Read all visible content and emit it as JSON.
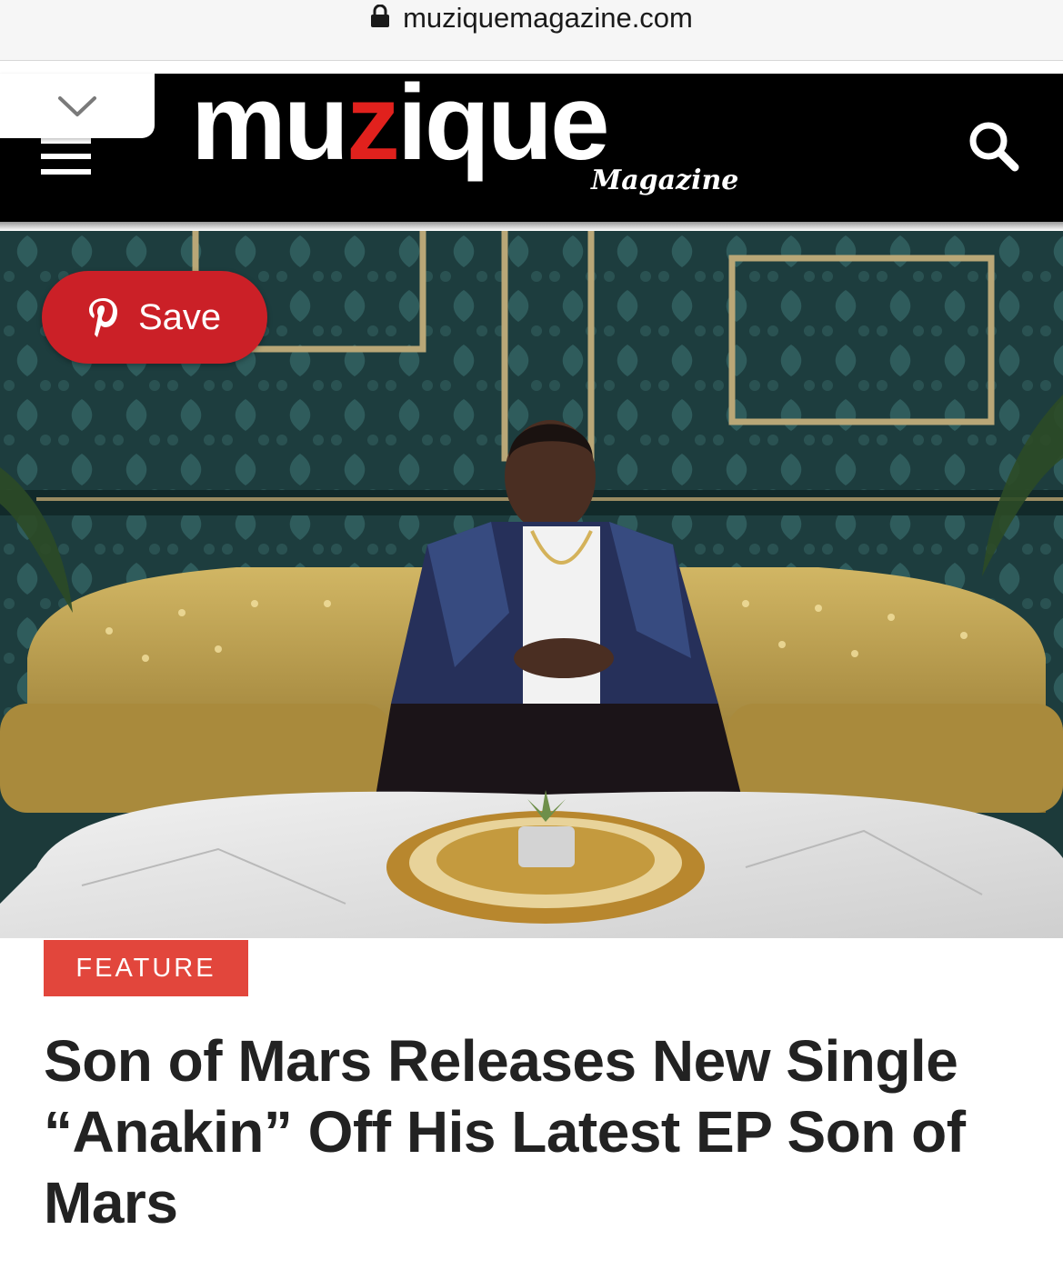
{
  "browser": {
    "url": "muziquemagazine.com"
  },
  "header": {
    "logo_main_pre": "mu",
    "logo_main_accent": "z",
    "logo_main_post": "ique",
    "logo_sub": "Magazine"
  },
  "hero": {
    "save_label": "Save"
  },
  "article": {
    "category": "FEATURE",
    "title": "Son of Mars Releases New Single “Anakin” Off His Latest EP Son of Mars"
  },
  "colors": {
    "header_bg": "#000000",
    "accent_red": "#e1211d",
    "pinterest_red": "#cb2027",
    "badge_red": "#e2463c"
  },
  "icons": [
    "lock-icon",
    "chevron-down-icon",
    "menu-icon",
    "search-icon",
    "pinterest-icon"
  ]
}
